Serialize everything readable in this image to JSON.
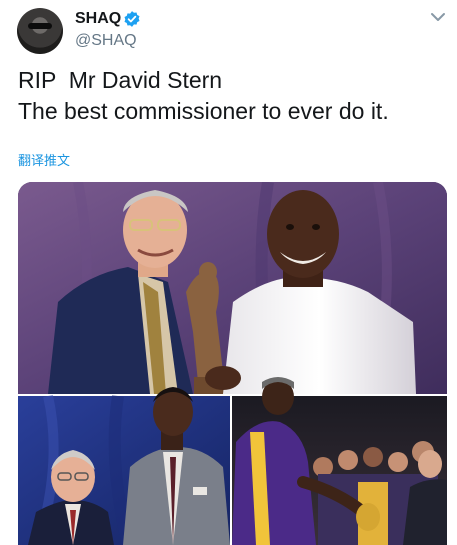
{
  "author": {
    "name": "SHAQ",
    "handle": "@SHAQ",
    "verified_icon": "verified-badge-icon",
    "avatar_icon": "avatar-photo"
  },
  "menu_icon": "chevron-down-icon",
  "tweet": {
    "line1": "RIP  Mr David Stern",
    "line2": "The best commissioner to ever do it."
  },
  "translate_label": "翻译推文",
  "colors": {
    "link": "#1b95e0",
    "verified": "#1da1f2",
    "secondary_text": "#657786",
    "primary_text": "#14171a"
  },
  "media": {
    "photo_top": "photo of two men holding a trophy against purple backdrop",
    "photo_bottom_left": "photo of two men in suits against blue backdrop",
    "photo_bottom_right": "photo of players on court with trophy"
  }
}
